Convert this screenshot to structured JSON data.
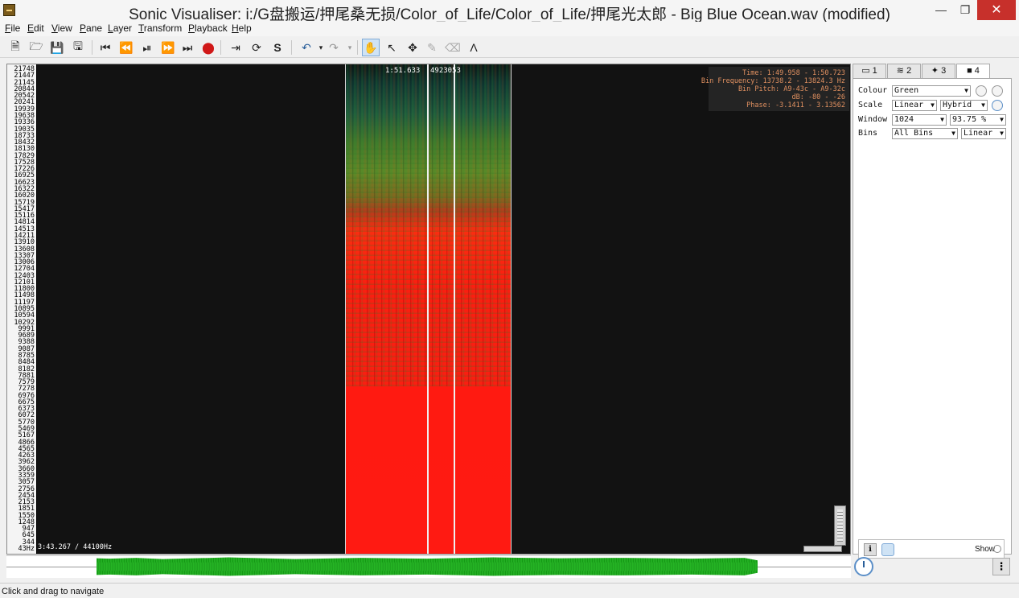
{
  "window": {
    "title": "Sonic Visualiser: i:/G盘搬运/押尾桑无损/Color_of_Life/Color_of_Life/押尾光太郎 - Big Blue Ocean.wav (modified)"
  },
  "menu": [
    "File",
    "Edit",
    "View",
    "Pane",
    "Layer",
    "Transform",
    "Playback",
    "Help"
  ],
  "toolbar": {
    "icons": [
      "new-file",
      "open-file",
      "save-file",
      "save-session",
      "rewind-start",
      "rewind",
      "play-pause",
      "fast-forward",
      "fast-forward-end",
      "record",
      "play-selection",
      "loop",
      "solo",
      "undo",
      "redo",
      "navigate",
      "select",
      "move",
      "draw",
      "erase",
      "measure"
    ]
  },
  "pane": {
    "frequency_ticks": [
      "21748",
      "21447",
      "21145",
      "20844",
      "20542",
      "20241",
      "19939",
      "19638",
      "19336",
      "19035",
      "18733",
      "18432",
      "18130",
      "17829",
      "17528",
      "17226",
      "16925",
      "16623",
      "16322",
      "16020",
      "15719",
      "15417",
      "15116",
      "14814",
      "14513",
      "14211",
      "13910",
      "13608",
      "13307",
      "13006",
      "12704",
      "12403",
      "12101",
      "11800",
      "11498",
      "11197",
      "10895",
      "10594",
      "10292",
      "9991",
      "9689",
      "9388",
      "9087",
      "8785",
      "8484",
      "8182",
      "7881",
      "7579",
      "7278",
      "6976",
      "6675",
      "6373",
      "6072",
      "5770",
      "5469",
      "5167",
      "4866",
      "4565",
      "4263",
      "3962",
      "3660",
      "3359",
      "3057",
      "2756",
      "2454",
      "2153",
      "1851",
      "1550",
      "1248",
      "947",
      "645",
      "344",
      "43Hz"
    ],
    "cursor_time": "1:51.633",
    "cursor_frame": "4923053",
    "info": {
      "time": "Time: 1:49.958 - 1:50.723",
      "bin_frequency": "Bin Frequency: 13738.2 - 13824.3 Hz",
      "bin_pitch": "Bin Pitch: A9-43c - A9-32c",
      "db": "dB: -80 - -26",
      "phase": "Phase: -3.1411 - 3.13562"
    },
    "duration": "3:43.267 / 44100Hz"
  },
  "properties": {
    "tabs": [
      "1",
      "2",
      "3",
      "4"
    ],
    "selected_tab": "4",
    "colour_label": "Colour",
    "colour_value": "Green",
    "scale_label": "Scale",
    "scale_value": "Linear",
    "scale_mode": "Hybrid",
    "window_label": "Window",
    "window_value": "1024",
    "window_overlap": "93.75 %",
    "bins_label": "Bins",
    "bins_value": "All Bins",
    "bins_mode": "Linear",
    "show_label": "Show"
  },
  "status": {
    "text": "Click and drag to navigate"
  },
  "colors": {
    "spectrogram_low": "#ff1a10",
    "spectrogram_high": "#1d5a3e",
    "waveform": "#1aa019",
    "close_button": "#c7302b"
  }
}
